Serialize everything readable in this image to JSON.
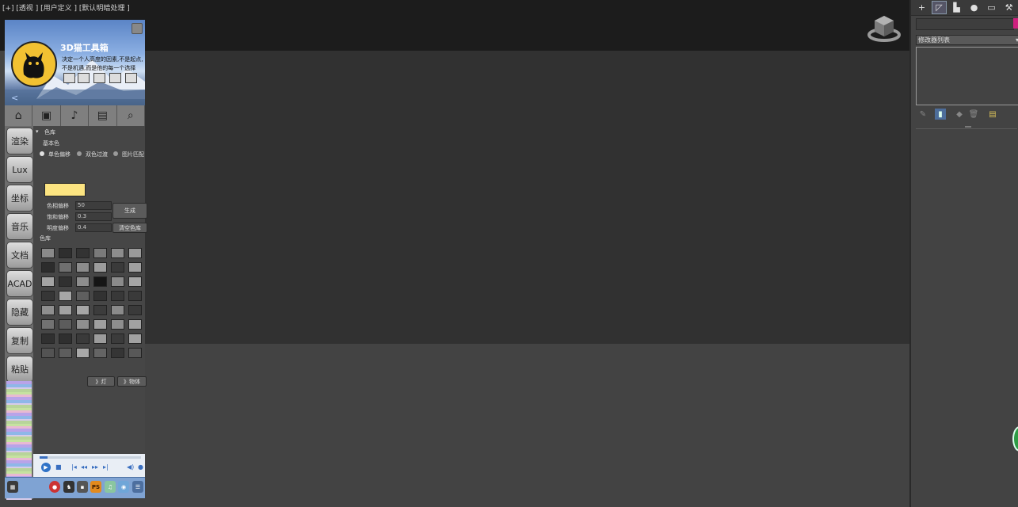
{
  "viewport": {
    "label": "[+] [透视 ] [用户定义 ] [默认明暗处理 ]"
  },
  "plugin": {
    "title": "3D猫工具箱",
    "desc_line1": "决定一个人高度的因素,不是起点,",
    "desc_line2": "不是机遇,而是他的每一个选择",
    "nav_back": "<",
    "top_icons": [
      "home-icon",
      "toolbox-icon",
      "bell-icon",
      "network-icon",
      "search-icon"
    ],
    "sidebar_buttons": [
      "渲染",
      "Lux",
      "坐标",
      "音乐",
      "文档",
      "ACAD",
      "隐藏",
      "复制",
      "粘贴"
    ],
    "section_title": "色库",
    "base_color_label": "基本色",
    "modes": [
      "单色偏移",
      "双色过渡",
      "图片匹配"
    ],
    "selected_mode": "单色偏移",
    "swatch_color": "#fce481",
    "fields": [
      {
        "label": "色相偏移",
        "value": "50"
      },
      {
        "label": "饱和偏移",
        "value": "0.3"
      },
      {
        "label": "明度偏移",
        "value": "0.4"
      }
    ],
    "generate_button": "生成",
    "clear_button": "清空色库",
    "library_title": "色库",
    "palette": [
      [
        "#8a8a8a",
        "#2e2e2e",
        "#333333",
        "#7a7a7a",
        "#8d8d8d",
        "#9a9a9a"
      ],
      [
        "#2c2c2c",
        "#6f6f6f",
        "#8c8c8c",
        "#9c9c9c",
        "#3a3a3a",
        "#a0a0a0"
      ],
      [
        "#a4a4a4",
        "#303030",
        "#8d8d8d",
        "#151515",
        "#8b8b8b",
        "#a6a6a6"
      ],
      [
        "#363636",
        "#a7a7a7",
        "#5f5f5f",
        "#323232",
        "#383838",
        "#3a3a3a"
      ],
      [
        "#8e8e8e",
        "#a1a1a1",
        "#a6a6a6",
        "#3c3c3c",
        "#8a8a8a",
        "#3a3a3a"
      ],
      [
        "#727272",
        "#5c5c5c",
        "#8f8f8f",
        "#9f9f9f",
        "#8e8e8e",
        "#a2a2a2"
      ],
      [
        "#303030",
        "#2f2f2f",
        "#3a3a3a",
        "#9c9c9c",
        "#3b3b3b",
        "#a1a1a1"
      ],
      [
        "#535353",
        "#5d5d5d",
        "#a9a9a9",
        "#646464",
        "#353535",
        "#585858"
      ]
    ],
    "apply_light_button": "》灯",
    "apply_object_button": "》物体"
  },
  "taskbar": {
    "items": [
      "windows-icon",
      "blank-icon",
      "blank-icon",
      "record-icon",
      "qq-icon",
      "remote-icon",
      "ps-icon",
      "music-icon",
      "app-icon",
      "menu-icon"
    ],
    "ps_label": "PS"
  },
  "command_panel": {
    "tabs": [
      "create-icon",
      "modify-icon",
      "hierarchy-icon",
      "motion-icon",
      "display-icon",
      "utilities-icon"
    ],
    "modifier_list": "修改器列表",
    "name_color": "#d0207f"
  }
}
